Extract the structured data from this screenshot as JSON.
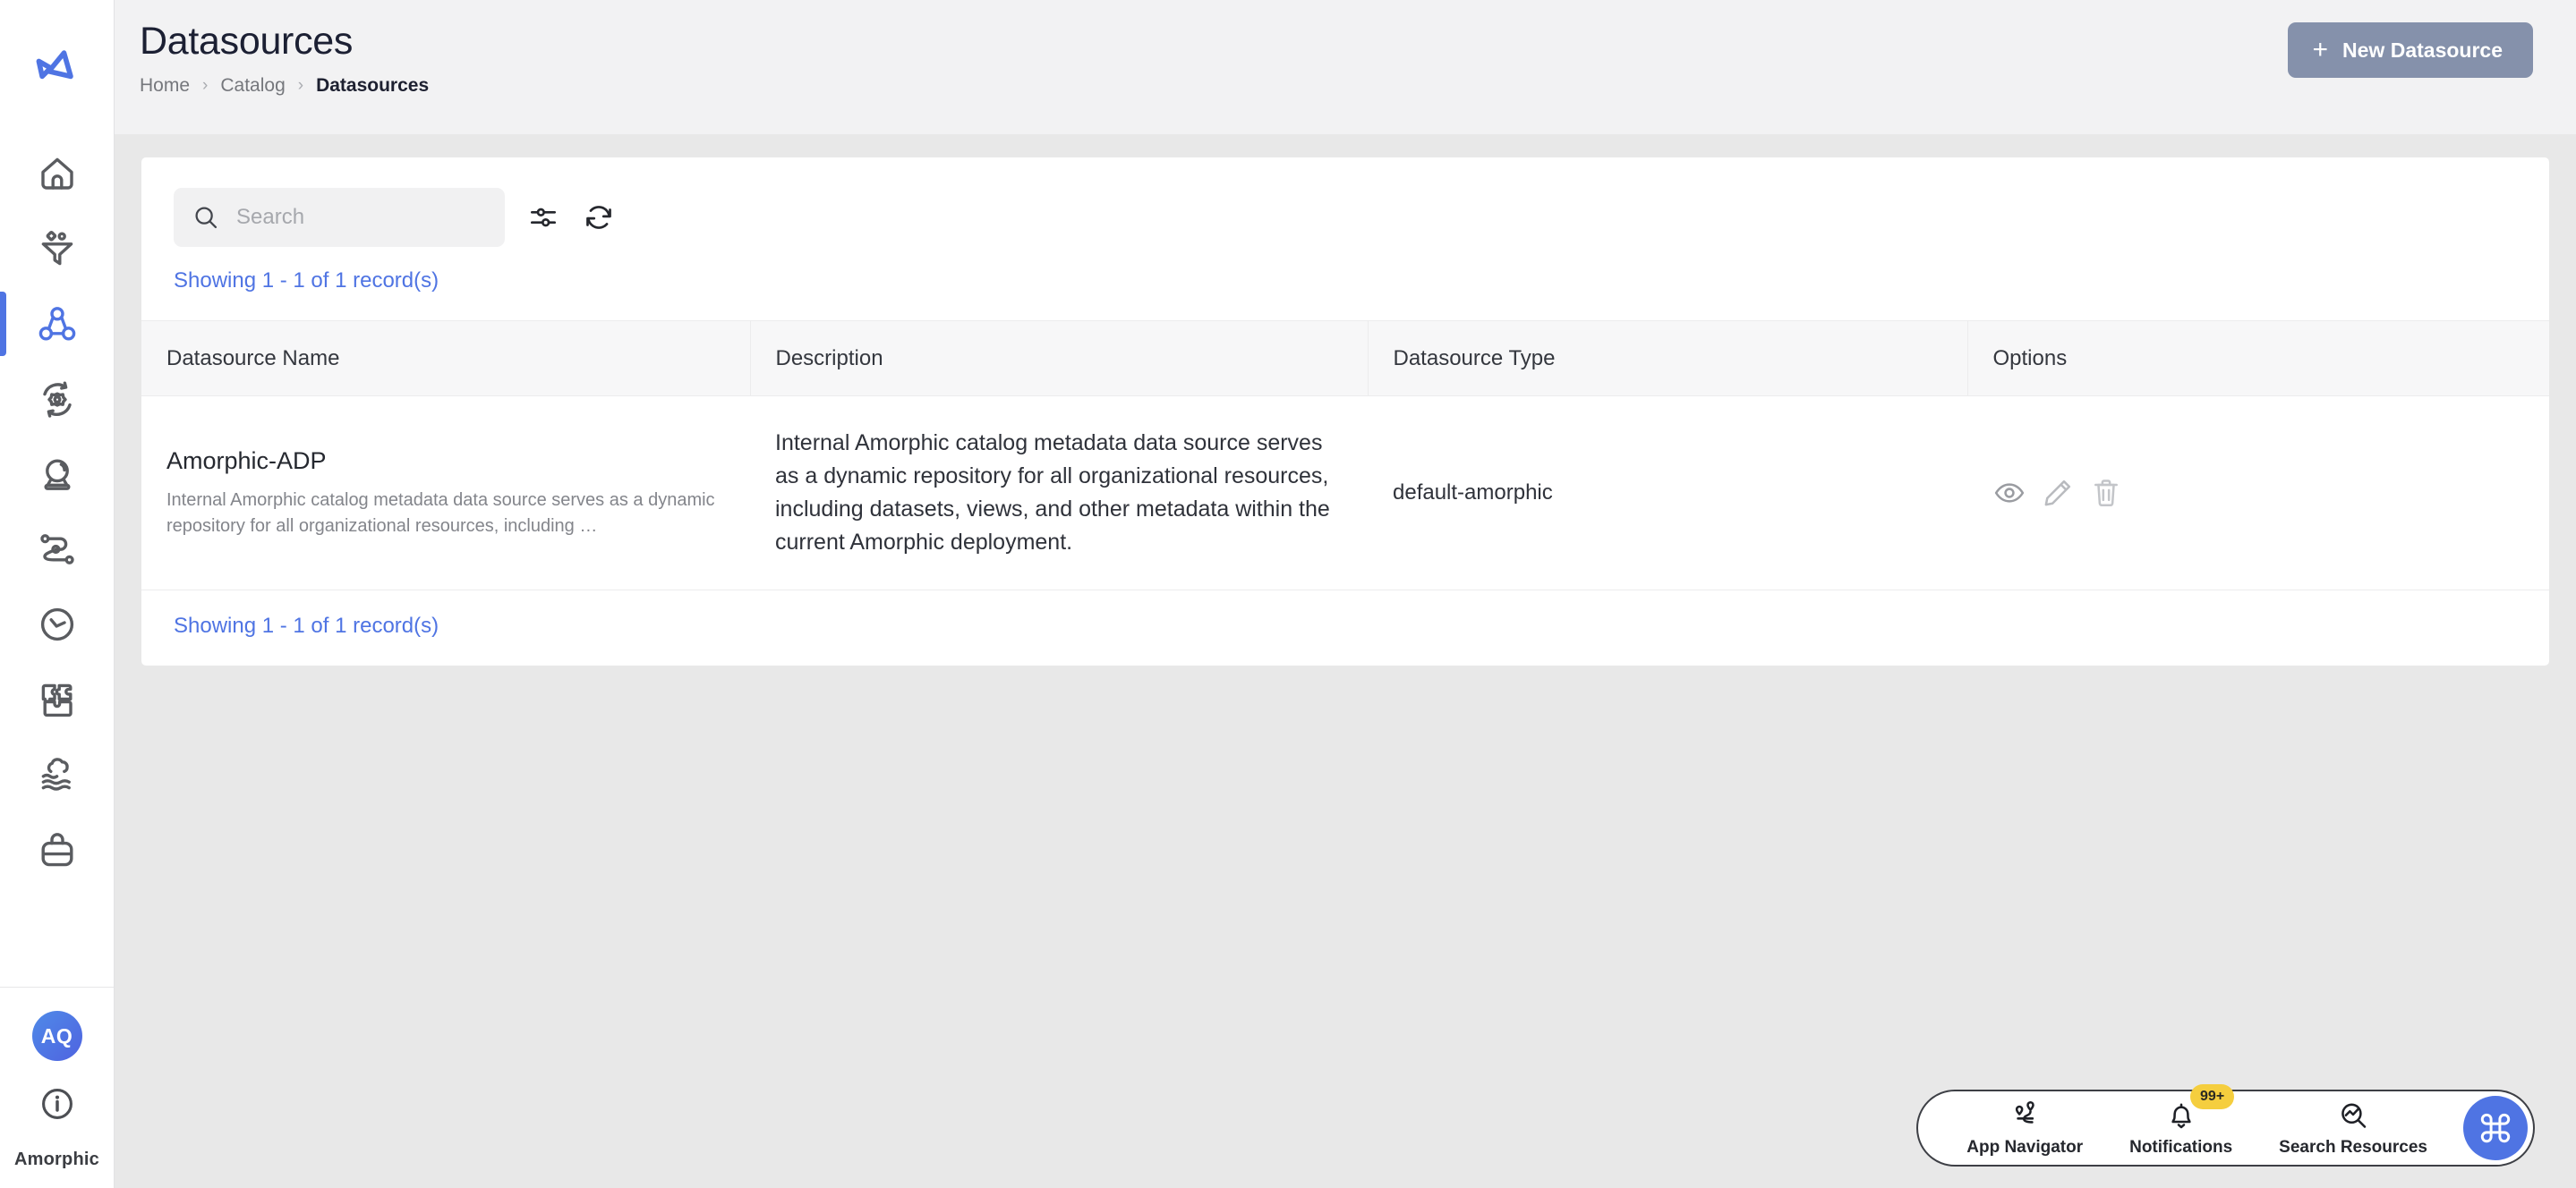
{
  "app": {
    "logo_name": "amorphic-logo",
    "brand_label": "Amorphic",
    "accent_color": "#4f74e3",
    "badge_color": "#f5ce3e",
    "button_color": "#8591ab"
  },
  "sidebar": {
    "items": [
      {
        "icon": "home-icon",
        "name": "home"
      },
      {
        "icon": "funnel-icon",
        "name": "data-ingestion"
      },
      {
        "icon": "catalog-icon",
        "name": "catalog",
        "active": true
      },
      {
        "icon": "gear-sync-icon",
        "name": "automation"
      },
      {
        "icon": "crystal-ball-icon",
        "name": "insights"
      },
      {
        "icon": "workflow-icon",
        "name": "workflows"
      },
      {
        "icon": "clock-icon",
        "name": "schedules"
      },
      {
        "icon": "puzzle-icon",
        "name": "extensions"
      },
      {
        "icon": "cloud-waves-icon",
        "name": "datalake"
      },
      {
        "icon": "bag-icon",
        "name": "marketplace"
      }
    ],
    "user": {
      "avatar_initials": "AQ",
      "info_icon": "info-icon"
    }
  },
  "header": {
    "title": "Datasources",
    "breadcrumb": [
      {
        "label": "Home",
        "current": false
      },
      {
        "label": "Catalog",
        "current": false
      },
      {
        "label": "Datasources",
        "current": true
      }
    ],
    "separator": "›",
    "new_button": {
      "label": "New Datasource",
      "plus": "+"
    }
  },
  "toolbar": {
    "search_placeholder": "Search",
    "search_value": "",
    "search_icon": "search-icon",
    "filter_icon": "sliders-icon",
    "refresh_icon": "refresh-icon"
  },
  "table": {
    "records_text_top": "Showing 1 - 1 of 1 record(s)",
    "records_text_bottom": "Showing 1 - 1 of 1 record(s)",
    "columns": [
      "Datasource Name",
      "Description",
      "Datasource Type",
      "Options"
    ],
    "rows": [
      {
        "name": "Amorphic-ADP",
        "name_subtitle": "Internal Amorphic catalog metadata data source serves as a dynamic repository for all organizational resources, including …",
        "description": "Internal Amorphic catalog metadata data source serves as a dynamic repository for all organizational resources, including datasets, views, and other metadata within the current Amorphic deployment.",
        "type": "default-amorphic",
        "actions": [
          {
            "icon": "eye-icon",
            "name": "view-datasource"
          },
          {
            "icon": "pencil-icon",
            "name": "edit-datasource"
          },
          {
            "icon": "trash-icon",
            "name": "delete-datasource"
          }
        ]
      }
    ]
  },
  "dock": {
    "items": [
      {
        "label": "App Navigator",
        "icon": "route-pin-icon",
        "badge": null
      },
      {
        "label": "Notifications",
        "icon": "bell-icon",
        "badge": "99+"
      },
      {
        "label": "Search Resources",
        "icon": "search-chart-icon",
        "badge": null
      }
    ],
    "command_button": {
      "icon": "command-icon",
      "glyph": "⌘"
    }
  }
}
